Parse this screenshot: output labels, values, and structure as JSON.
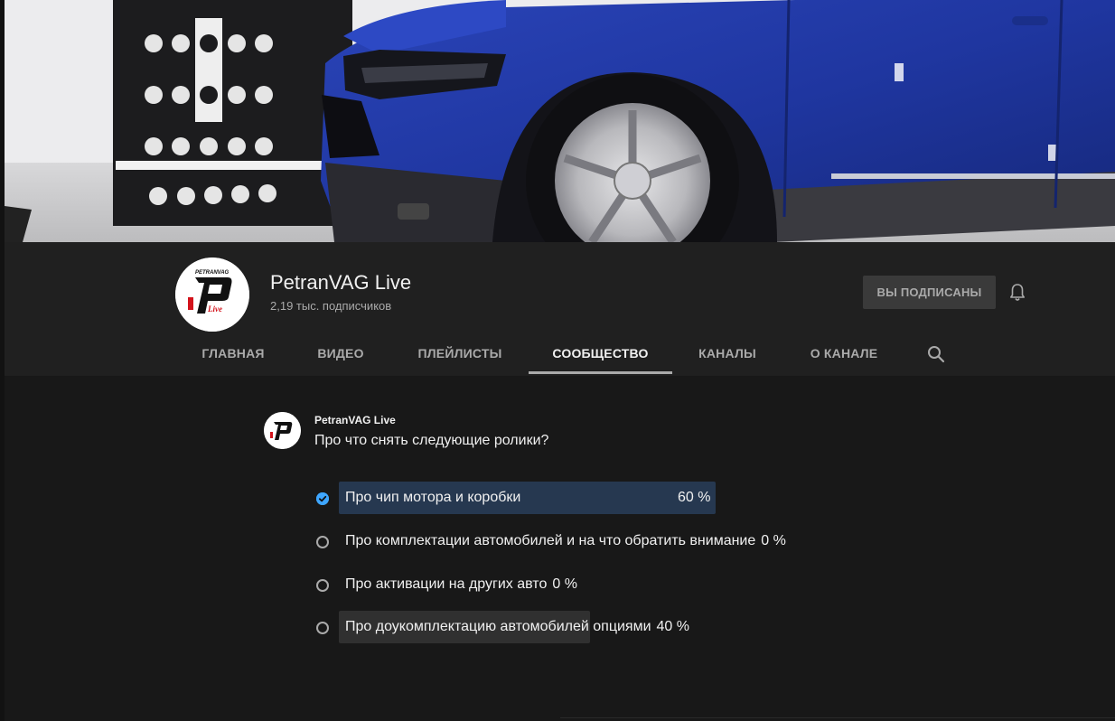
{
  "channel": {
    "name": "PetranVAG Live",
    "subscribers": "2,19 тыс. подписчиков",
    "subscribe_label": "ВЫ ПОДПИСАНЫ",
    "logo_top_text": "PETRANVAG",
    "logo_bottom_text": "Live"
  },
  "tabs": [
    {
      "label": "ГЛАВНАЯ",
      "active": false
    },
    {
      "label": "ВИДЕО",
      "active": false
    },
    {
      "label": "ПЛЕЙЛИСТЫ",
      "active": false
    },
    {
      "label": "СООБЩЕСТВО",
      "active": true
    },
    {
      "label": "КАНАЛЫ",
      "active": false
    },
    {
      "label": "О КАНАЛЕ",
      "active": false
    }
  ],
  "post": {
    "author": "PetranVAG Live",
    "text": "Про что снять следующие ролики?",
    "poll": [
      {
        "label": "Про чип мотора и коробки",
        "percent": "60 %",
        "value": 60,
        "selected": true
      },
      {
        "label": "Про комплектации автомобилей и на что обратить внимание",
        "percent": "0 %",
        "value": 0,
        "selected": false
      },
      {
        "label": "Про активации на других авто",
        "percent": "0 %",
        "value": 0,
        "selected": false
      },
      {
        "label": "Про доукомплектацию автомобилей опциями",
        "percent": "40 %",
        "value": 40,
        "selected": false
      }
    ]
  },
  "icons": {
    "bell": "bell-icon",
    "search": "search-icon",
    "check": "check-circle-icon"
  },
  "colors": {
    "selected_fill": "#263850",
    "poll_fill": "#303030",
    "accent": "#3ea6ff"
  }
}
